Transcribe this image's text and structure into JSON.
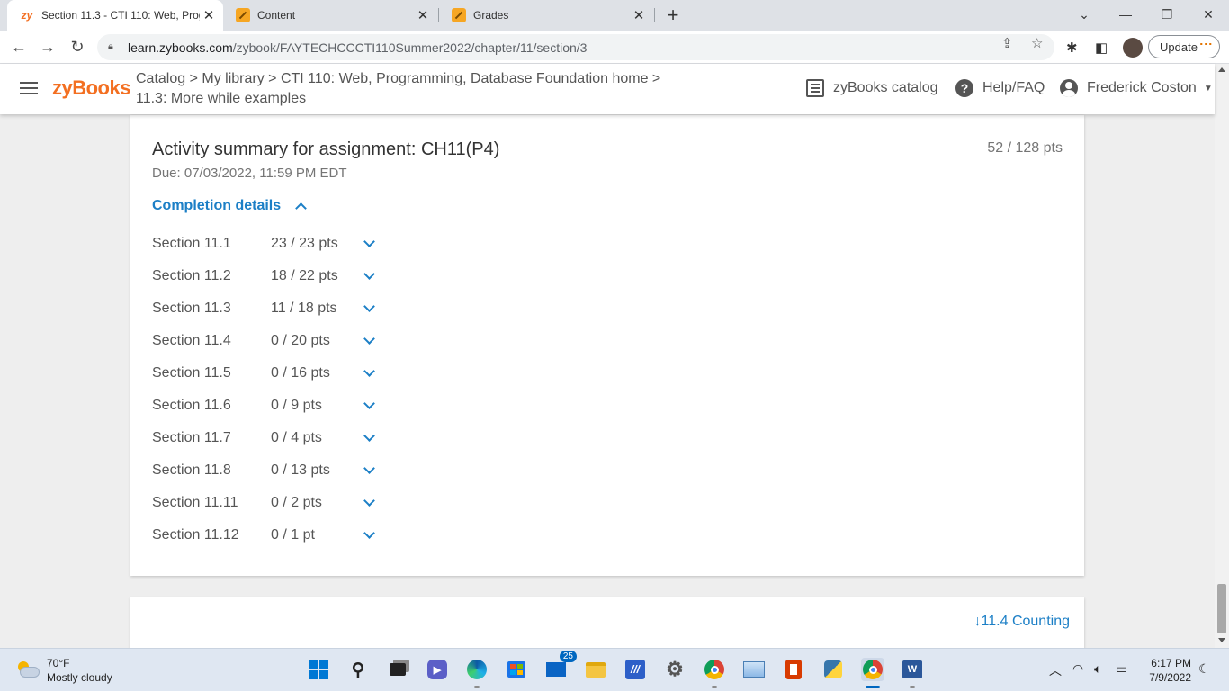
{
  "browser": {
    "tabs": [
      {
        "title": "Section 11.3 - CTI 110: Web, Prog",
        "icon": "zybooks-favicon",
        "active": true
      },
      {
        "title": "Content",
        "icon": "pencil-favicon",
        "active": false
      },
      {
        "title": "Grades",
        "icon": "pencil-favicon",
        "active": false
      }
    ],
    "new_tab": "+",
    "url_host": "learn.zybooks.com",
    "url_path": "/zybook/FAYTECHCCCTI110Summer2022/chapter/11/section/3",
    "update_label": "Update"
  },
  "header": {
    "logo": "zyBooks",
    "breadcrumb_line1": "Catalog > My library > CTI 110: Web, Programming, Database Foundation home >",
    "breadcrumb_line2": "11.3: More while examples",
    "catalog_label": "zyBooks catalog",
    "help_label": "Help/FAQ",
    "user_name": "Frederick Coston"
  },
  "activity": {
    "title": "Activity summary for assignment: CH11(P4)",
    "due": "Due: 07/03/2022, 11:59 PM EDT",
    "total_points": "52 / 128 pts",
    "completion_label": "Completion details",
    "sections": [
      {
        "name": "Section 11.1",
        "score": "23 / 23 pts"
      },
      {
        "name": "Section 11.2",
        "score": "18 / 22 pts"
      },
      {
        "name": "Section 11.3",
        "score": "11 / 18 pts"
      },
      {
        "name": "Section 11.4",
        "score": "0 / 20 pts"
      },
      {
        "name": "Section 11.5",
        "score": "0 / 16 pts"
      },
      {
        "name": "Section 11.6",
        "score": "0 / 9 pts"
      },
      {
        "name": "Section 11.7",
        "score": "0 / 4 pts"
      },
      {
        "name": "Section 11.8",
        "score": "0 / 13 pts"
      },
      {
        "name": "Section 11.11",
        "score": "0 / 2 pts"
      },
      {
        "name": "Section 11.12",
        "score": "0 / 1 pt"
      }
    ]
  },
  "next_section": {
    "label": "11.4 Counting",
    "arrow": "↓"
  },
  "taskbar": {
    "temperature": "70°F",
    "weather": "Mostly cloudy",
    "mail_badge": "25",
    "time": "6:17 PM",
    "date": "7/9/2022"
  },
  "colors": {
    "brand": "#f36f21",
    "link": "#1c7fc6",
    "text": "#555555"
  }
}
